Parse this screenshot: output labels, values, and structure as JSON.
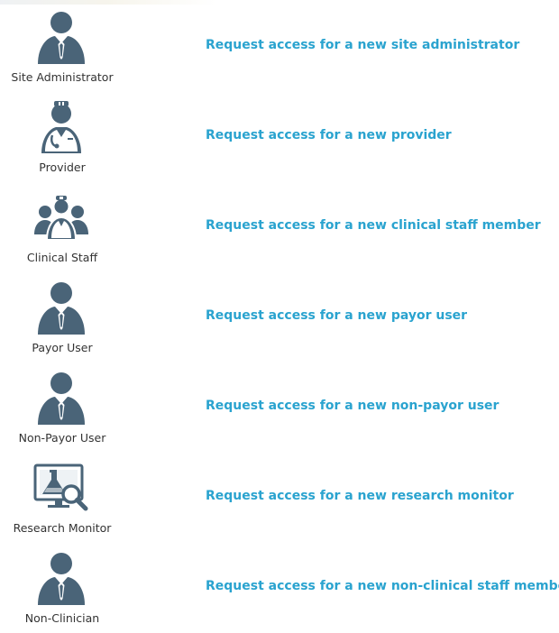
{
  "colors": {
    "icon": "#4a6478",
    "link": "#2aa3cf",
    "label": "#333333"
  },
  "roles": [
    {
      "label": "Site Administrator",
      "link": "Request access for a new site administrator",
      "icon": "businessman-icon"
    },
    {
      "label": "Provider",
      "link": "Request access for a new provider",
      "icon": "doctor-icon"
    },
    {
      "label": "Clinical Staff",
      "link": "Request access for a new clinical staff member",
      "icon": "medical-team-icon"
    },
    {
      "label": "Payor User",
      "link": "Request access for a new payor user",
      "icon": "businessman-icon"
    },
    {
      "label": "Non-Payor User",
      "link": "Request access for a new non-payor user",
      "icon": "businessman-icon"
    },
    {
      "label": "Research Monitor",
      "link": "Request access for a new research monitor",
      "icon": "lab-monitor-icon"
    },
    {
      "label": "Non-Clinician",
      "link": "Request access for a new non-clinical staff member",
      "icon": "businessman-icon"
    }
  ]
}
